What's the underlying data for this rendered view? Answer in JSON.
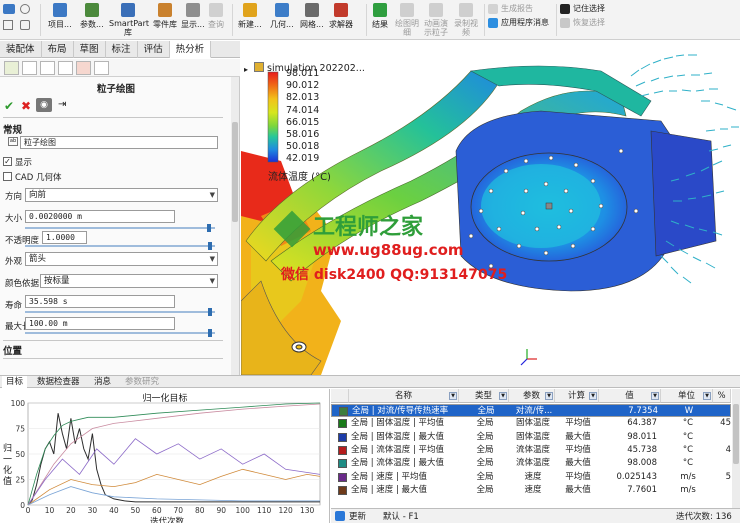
{
  "ribbon": {
    "big_buttons": [
      {
        "label": "项目...",
        "color": "#3b78c4"
      },
      {
        "label": "参数...",
        "color": "#4c8a3c"
      },
      {
        "label": "SmartPart 库",
        "color": "#3a6fb8"
      },
      {
        "label": "零件库",
        "color": "#c9812e"
      },
      {
        "label": "显示...",
        "color": "#8e8e8e"
      },
      {
        "label": "查询",
        "color": "#b9b9b9"
      },
      {
        "label": "新建...",
        "color": "#e0a31c"
      },
      {
        "label": "几何...",
        "color": "#3d7dc8"
      },
      {
        "label": "网格...",
        "color": "#6a6a6a"
      },
      {
        "label": "求解器",
        "color": "#c23a2b"
      },
      {
        "label": "结果",
        "color": "#2f9e3f"
      },
      {
        "label": "绘图明 细",
        "color": "#b3b3b3"
      },
      {
        "label": "动画演 示粒子",
        "color": "#b3b3b3"
      },
      {
        "label": "录制视 频",
        "color": "#b3b3b3"
      }
    ],
    "mid_rows": [
      {
        "label": "生成报告",
        "dim": true
      },
      {
        "label": "应用程序消息",
        "dim": false
      }
    ],
    "right_rows": [
      {
        "label": "记住选择",
        "dim": false
      },
      {
        "label": "恢复选择",
        "dim": true
      }
    ]
  },
  "tabs": [
    "装配体",
    "布局",
    "草图",
    "标注",
    "评估",
    "热分析"
  ],
  "active_tab": "热分析",
  "panel": {
    "title": "粒子绘图",
    "section_general": "常规",
    "name_value": "粒子绘图",
    "show_label": "显示",
    "cad_label": "CAD 几何体",
    "direction_label": "方向",
    "direction_value": "向前",
    "size_label": "大小",
    "size_value": "0.0020000 m",
    "opacity_label": "不透明度",
    "opacity_value": "1.0000",
    "appearance_label": "外观",
    "appearance_value": "箭头",
    "colorby_label": "颜色依据",
    "colorby_value": "按标量",
    "life_label": "寿命",
    "life_value": "35.598 s",
    "maxlen_label": "最大长度",
    "maxlen_value": "100.00 m",
    "section_position": "位置"
  },
  "legend": {
    "title": "simulation 202202...",
    "values": [
      "98.011",
      "90.012",
      "82.013",
      "74.014",
      "66.015",
      "58.016",
      "50.018",
      "42.019"
    ],
    "label": "流体温度 (°C)"
  },
  "watermark": {
    "title": "工程师之家",
    "url": "www.ug88ug.com",
    "contact": "微信 disk2400 QQ:913147075"
  },
  "bottom_tabs": [
    "目标",
    "数据检查器",
    "消息",
    "参数研究"
  ],
  "chart_data": {
    "type": "line",
    "title": "归一化目标",
    "xlabel": "迭代次数",
    "ylabel": "归一化值",
    "xlim": [
      0,
      136
    ],
    "ylim": [
      0,
      100
    ],
    "xticks": [
      0,
      10,
      20,
      30,
      40,
      50,
      60,
      70,
      80,
      90,
      100,
      110,
      120,
      130
    ],
    "yticks": [
      0,
      25,
      50,
      75,
      100
    ],
    "series": [
      {
        "color": "#2d2d2d",
        "x": [
          0,
          2,
          4,
          6,
          8,
          10,
          12,
          14,
          16,
          18,
          20,
          22,
          24,
          26,
          28,
          30,
          32,
          34,
          36,
          40,
          45,
          50,
          60,
          70,
          80,
          90,
          100,
          110,
          120,
          130,
          136
        ],
        "y": [
          0,
          5,
          20,
          40,
          55,
          62,
          50,
          90,
          70,
          55,
          85,
          60,
          75,
          55,
          45,
          70,
          35,
          20,
          10,
          6,
          4,
          3,
          3,
          3,
          3,
          3,
          3,
          3,
          3,
          3,
          3
        ]
      },
      {
        "color": "#2e8b57",
        "x": [
          0,
          4,
          8,
          12,
          16,
          20,
          24,
          28,
          30,
          40,
          60,
          80,
          100,
          120,
          136
        ],
        "y": [
          0,
          30,
          55,
          68,
          78,
          82,
          84,
          86,
          86,
          86,
          90,
          93,
          96,
          99,
          100
        ]
      },
      {
        "color": "#c98ba0",
        "x": [
          0,
          6,
          12,
          20,
          30,
          40,
          60,
          80,
          100,
          120,
          136
        ],
        "y": [
          0,
          20,
          40,
          60,
          75,
          80,
          85,
          90,
          94,
          97,
          99
        ]
      },
      {
        "color": "#8c6ac8",
        "x": [
          0,
          8,
          16,
          24,
          32,
          40,
          50,
          60,
          70,
          80,
          90,
          100,
          110,
          120,
          136
        ],
        "y": [
          0,
          25,
          45,
          30,
          55,
          40,
          65,
          50,
          60,
          45,
          55,
          40,
          50,
          35,
          30
        ]
      },
      {
        "color": "#d08a3a",
        "x": [
          0,
          10,
          20,
          30,
          40,
          50,
          60,
          70,
          80,
          90,
          100,
          110,
          120,
          130,
          136
        ],
        "y": [
          0,
          15,
          25,
          20,
          18,
          22,
          30,
          25,
          20,
          28,
          35,
          30,
          25,
          30,
          28
        ]
      },
      {
        "color": "#7aa4d6",
        "x": [
          0,
          10,
          20,
          30,
          40,
          60,
          80,
          100,
          120,
          136
        ],
        "y": [
          0,
          10,
          18,
          12,
          8,
          6,
          5,
          4,
          4,
          4
        ]
      }
    ]
  },
  "table": {
    "columns": [
      "名称",
      "类型",
      "参数",
      "计算",
      "值",
      "单位",
      "%"
    ],
    "rows": [
      {
        "swatch": "#3d7d3d",
        "name": "全局 | 对流/传导传热速率",
        "type": "全局",
        "param": "对流/传...",
        "calc": "",
        "value": "7.7354",
        "unit": "W",
        "pct": "",
        "selected": true
      },
      {
        "swatch": "#1a7a1a",
        "name": "全局 | 固体温度 | 平均值",
        "type": "全局",
        "param": "固体温度",
        "calc": "平均值",
        "value": "64.387",
        "unit": "°C",
        "pct": "45",
        "selected": false
      },
      {
        "swatch": "#1d3ca8",
        "name": "全局 | 固体温度 | 最大值",
        "type": "全局",
        "param": "固体温度",
        "calc": "最大值",
        "value": "98.011",
        "unit": "°C",
        "pct": "",
        "selected": false
      },
      {
        "swatch": "#b51d1d",
        "name": "全局 | 流体温度 | 平均值",
        "type": "全局",
        "param": "流体温度",
        "calc": "平均值",
        "value": "45.738",
        "unit": "°C",
        "pct": "4",
        "selected": false
      },
      {
        "swatch": "#1f8c84",
        "name": "全局 | 流体温度 | 最大值",
        "type": "全局",
        "param": "流体温度",
        "calc": "最大值",
        "value": "98.008",
        "unit": "°C",
        "pct": "",
        "selected": false
      },
      {
        "swatch": "#6a2a8a",
        "name": "全局 | 速度 | 平均值",
        "type": "全局",
        "param": "速度",
        "calc": "平均值",
        "value": "0.025143",
        "unit": "m/s",
        "pct": "5",
        "selected": false
      },
      {
        "swatch": "#6e3a1a",
        "name": "全局 | 速度 | 最大值",
        "type": "全局",
        "param": "速度",
        "calc": "最大值",
        "value": "7.7601",
        "unit": "m/s",
        "pct": "",
        "selected": false
      }
    ]
  },
  "status": {
    "update_label": "更新",
    "config_label": "默认 - F1",
    "iterations_label": "迭代次数: 136"
  },
  "colors": {
    "legend_gradient": [
      "#e81b1b",
      "#f06b16",
      "#f2c21a",
      "#d6e61e",
      "#7cd63c",
      "#27c79a",
      "#1f8be0",
      "#1c2fd6"
    ],
    "selected_row": "#1f64c8",
    "watermark_green": "#2f9e3a",
    "watermark_red": "#e01e1e"
  }
}
